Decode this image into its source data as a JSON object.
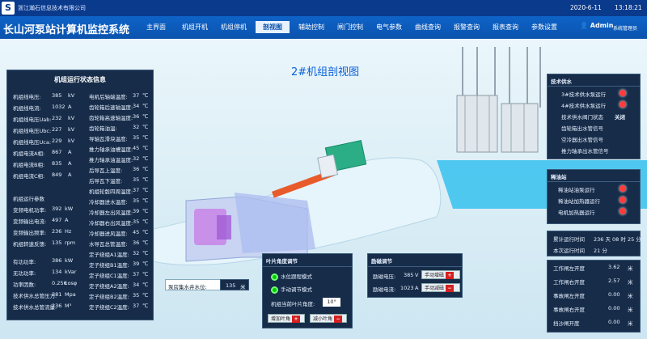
{
  "topbar": {
    "logo": "S",
    "company": "浙江瀚石信息技术有限公司",
    "date": "2020-6-11",
    "time": "13:18:21"
  },
  "nav": {
    "title": "长山河泵站计算机监控系统",
    "tabs": [
      "主界面",
      "机组开机",
      "机组停机",
      "剖视图",
      "辅助控制",
      "闸门控制",
      "电气参数",
      "曲线查询",
      "报警查询",
      "报表查询",
      "参数设置"
    ],
    "active_index": 3,
    "user": "Admin",
    "sys_mgr": "系统管理员"
  },
  "view_title": "2#机组剖视图",
  "left_panel": {
    "title": "机组运行状态信息",
    "elec": [
      {
        "label": "机组线电压:",
        "value": "385",
        "unit": "kV"
      },
      {
        "label": "机组线电流:",
        "value": "1032",
        "unit": "A"
      },
      {
        "label": "机组线电压Uab:",
        "value": "232",
        "unit": "kV"
      },
      {
        "label": "机组线电压Ubc:",
        "value": "227",
        "unit": "kV"
      },
      {
        "label": "机组线电压Uca:",
        "value": "229",
        "unit": "kV"
      },
      {
        "label": "机组电流A相:",
        "value": "867",
        "unit": "A"
      },
      {
        "label": "机组电流B相:",
        "value": "835",
        "unit": "A"
      },
      {
        "label": "机组电流C相:",
        "value": "849",
        "unit": "A"
      }
    ],
    "vfd": [
      {
        "label": "机组运行参数",
        "value": "",
        "unit": ""
      },
      {
        "label": "变频电机功率:",
        "value": "392",
        "unit": "kW"
      },
      {
        "label": "变频输出电流:",
        "value": "497",
        "unit": "A"
      },
      {
        "label": "变频输出频率:",
        "value": "236",
        "unit": "Hz"
      },
      {
        "label": "机组转速反馈:",
        "value": "135",
        "unit": "rpm"
      }
    ],
    "power": [
      {
        "label": "有功功率:",
        "value": "386",
        "unit": "kW"
      },
      {
        "label": "无功功率:",
        "value": "134",
        "unit": "kVar"
      },
      {
        "label": "功率因数:",
        "value": "0.256",
        "unit": "cosφ"
      },
      {
        "label": "技术供水总管压力:",
        "value": "381",
        "unit": "Mpa"
      },
      {
        "label": "技术供水总管流量:",
        "value": "236",
        "unit": "M³"
      }
    ],
    "temps": [
      {
        "label": "电机后轴端温度:",
        "value": "37",
        "unit": "℃"
      },
      {
        "label": "齿轮箱后速轴温度:",
        "value": "34",
        "unit": "℃"
      },
      {
        "label": "齿轮箱高速轴温度:",
        "value": "36",
        "unit": "℃"
      },
      {
        "label": "齿轮箱油温:",
        "value": "32",
        "unit": "℃"
      },
      {
        "label": "导轴瓦滑块温度:",
        "value": "35",
        "unit": "℃"
      },
      {
        "label": "推力轴承油槽温度:",
        "value": "45",
        "unit": "℃"
      },
      {
        "label": "推力轴承油温温度:",
        "value": "32",
        "unit": "℃"
      },
      {
        "label": "后导瓦上温度:",
        "value": "36",
        "unit": "℃"
      },
      {
        "label": "后导瓦下温度:",
        "value": "35",
        "unit": "℃"
      },
      {
        "label": "机组轮毂四周温度:",
        "value": "37",
        "unit": "℃"
      },
      {
        "label": "冷却器进水温度:",
        "value": "35",
        "unit": "℃"
      },
      {
        "label": "冷却器左出风温度:",
        "value": "39",
        "unit": "℃"
      },
      {
        "label": "冷却器右出风温度:",
        "value": "35",
        "unit": "℃"
      },
      {
        "label": "冷却器进风温度:",
        "value": "45",
        "unit": "℃"
      },
      {
        "label": "水导瓦总管温度:",
        "value": "36",
        "unit": "℃"
      },
      {
        "label": "定子绕组A1温度:",
        "value": "32",
        "unit": "℃"
      },
      {
        "label": "定子绕组B1温度:",
        "value": "39",
        "unit": "℃"
      },
      {
        "label": "定子绕组C1温度:",
        "value": "37",
        "unit": "℃"
      },
      {
        "label": "定子绕组A2温度:",
        "value": "34",
        "unit": "℃"
      },
      {
        "label": "定子绕组B2温度:",
        "value": "35",
        "unit": "℃"
      },
      {
        "label": "定子绕组C2温度:",
        "value": "37",
        "unit": "℃"
      }
    ]
  },
  "water_level": {
    "label": "泵房集水井水位:",
    "value": "135",
    "unit": "米"
  },
  "blade_panel": {
    "title": "叶片角度调节",
    "mode_a": "水位跟程模式",
    "mode_b": "手动调节模式",
    "angle_label": "机组当前叶片角度:",
    "angle_value": "10",
    "angle_unit": "°",
    "inc": "增加叶角",
    "dec": "减小叶角"
  },
  "exc_panel": {
    "title": "励磁调节",
    "volt_label": "励磁电压:",
    "volt_value": "385",
    "volt_unit": "V",
    "volt_btn": "手动增磁",
    "curr_label": "励磁电流:",
    "curr_value": "1023",
    "curr_unit": "A",
    "curr_btn": "手动减磁"
  },
  "right_water": {
    "title": "技术供水",
    "items": [
      {
        "label": "3#技术供水泵运行",
        "led": true
      },
      {
        "label": "4#技术供水泵运行",
        "led": true
      },
      {
        "label": "技术供水阀门状态",
        "status": "关闭"
      },
      {
        "label": "齿轮箱出水管信号",
        "led": false
      },
      {
        "label": "空冷器出水管信号",
        "led": false
      },
      {
        "label": "推力轴承出水管信号",
        "led": false
      }
    ]
  },
  "right_oil": {
    "title": "稀油站",
    "items": [
      {
        "label": "稀油站油泵运行",
        "led": true
      },
      {
        "label": "稀油站加热器运行",
        "led": true
      },
      {
        "label": "电机加热器运行",
        "led": true
      }
    ]
  },
  "right_runtime": [
    {
      "label": "累计运行时间",
      "value": "236 天 08 时 25 分"
    },
    {
      "label": "本次运行时间",
      "value": "21 分"
    }
  ],
  "right_gates": [
    {
      "label": "工作闸左开度",
      "value": "3.62",
      "unit": "米"
    },
    {
      "label": "工作闸右开度",
      "value": "2.57",
      "unit": "米"
    },
    {
      "label": "事故闸左开度",
      "value": "0.00",
      "unit": "米"
    },
    {
      "label": "事故闸右开度",
      "value": "0.00",
      "unit": "米"
    },
    {
      "label": "挡沙闸开度",
      "value": "0.00",
      "unit": "米"
    }
  ],
  "colors": {
    "nav": "#0b53ad",
    "panel": "#162c49",
    "led_on": "#ff3b3b"
  }
}
